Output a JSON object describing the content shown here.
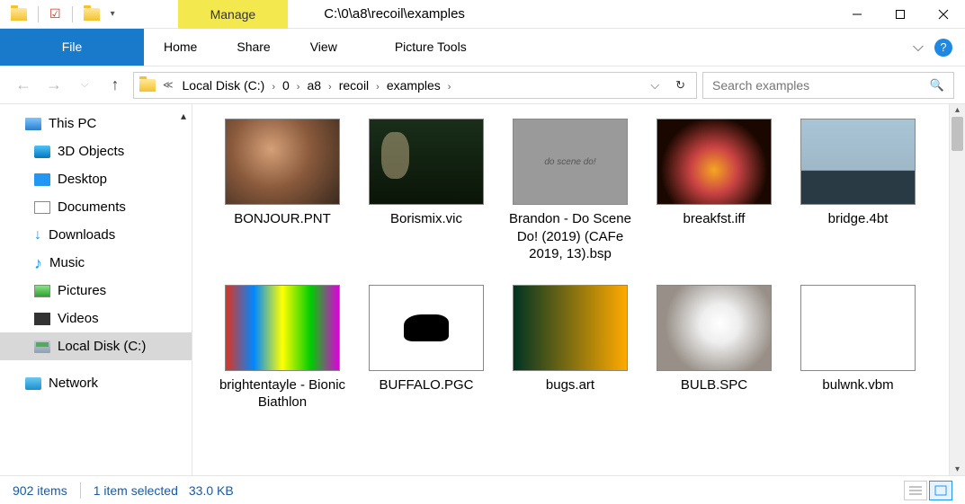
{
  "title_path": "C:\\0\\a8\\recoil\\examples",
  "manage_label": "Manage",
  "ribbon": {
    "file": "File",
    "home": "Home",
    "share": "Share",
    "view": "View",
    "tools": "Picture Tools"
  },
  "breadcrumb": [
    "Local Disk (C:)",
    "0",
    "a8",
    "recoil",
    "examples"
  ],
  "search_placeholder": "Search examples",
  "sidebar": {
    "root": "This PC",
    "items": [
      "3D Objects",
      "Desktop",
      "Documents",
      "Downloads",
      "Music",
      "Pictures",
      "Videos",
      "Local Disk (C:)"
    ],
    "network": "Network"
  },
  "files": [
    {
      "name": "BONJOUR.PNT",
      "th": "th-bonjour"
    },
    {
      "name": "Borismix.vic",
      "th": "th-boris"
    },
    {
      "name": "Brandon - Do Scene Do! (2019) (CAFe 2019, 13).bsp",
      "th": "th-brandon",
      "inner": "do scene do!"
    },
    {
      "name": "breakfst.iff",
      "th": "th-break"
    },
    {
      "name": "bridge.4bt",
      "th": "th-bridge"
    },
    {
      "name": "brightentayle - Bionic Biathlon",
      "th": "th-bright"
    },
    {
      "name": "BUFFALO.PGC",
      "th": "th-buffalo"
    },
    {
      "name": "bugs.art",
      "th": "th-bugs"
    },
    {
      "name": "BULB.SPC",
      "th": "th-bulb"
    },
    {
      "name": "bulwnk.vbm",
      "th": "th-bulwnk"
    }
  ],
  "status": {
    "count": "902 items",
    "selected": "1 item selected",
    "size": "33.0 KB"
  }
}
